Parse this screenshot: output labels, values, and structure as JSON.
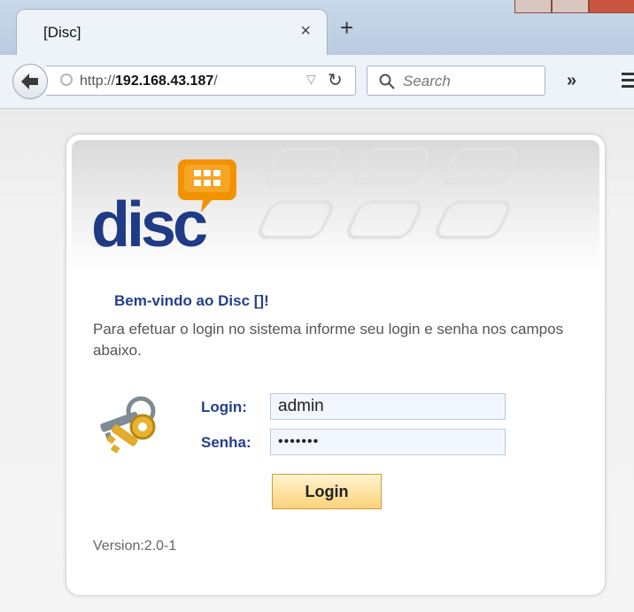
{
  "browser": {
    "tab_title": "[Disc]",
    "tab_close": "×",
    "new_tab": "+",
    "url_scheme": "http://",
    "url_host": "192.168.43.187",
    "url_path": "/",
    "search_placeholder": "Search",
    "overflow": "»"
  },
  "brand": {
    "logo_text": "disc"
  },
  "login": {
    "welcome": "Bem-vindo ao Disc []!",
    "instructions": "Para efetuar o login no sistema informe seu login e senha nos campos abaixo.",
    "login_label": "Login:",
    "login_value": "admin",
    "password_label": "Senha:",
    "password_value": "•••••••",
    "button_label": "Login",
    "version": "Version:2.0-1"
  },
  "colors": {
    "brand_blue": "#1f3b86",
    "logo_orange": "#f39200",
    "button_gradient_top": "#fff4cf",
    "button_gradient_bottom": "#fcd27a"
  }
}
